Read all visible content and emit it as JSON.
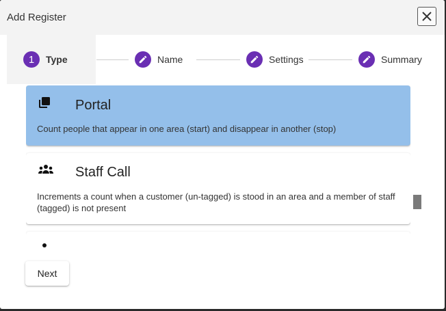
{
  "dialog": {
    "title": "Add Register",
    "close_icon": "close-icon"
  },
  "stepper": {
    "steps": [
      {
        "marker": "1",
        "label": "Type",
        "state": "active"
      },
      {
        "marker": "edit-icon",
        "label": "Name",
        "state": "pending"
      },
      {
        "marker": "edit-icon",
        "label": "Settings",
        "state": "pending"
      },
      {
        "marker": "edit-icon",
        "label": "Summary",
        "state": "pending"
      }
    ],
    "accent_color": "#6a2fb3"
  },
  "register_types": [
    {
      "icon": "copy-stack-icon",
      "title": "Portal",
      "description": "Count people that appear in one area (start) and disappear in another (stop)",
      "selected": true
    },
    {
      "icon": "people-group-icon",
      "title": "Staff Call",
      "description": "Increments a count when a customer (un-tagged) is stood in an area and a member of staff (tagged) is not present",
      "selected": false
    },
    {
      "icon": "person-icon",
      "title": "",
      "description": "",
      "selected": false
    }
  ],
  "colors": {
    "selected_card": "#94bfea",
    "header_bg": "#f3f3f3"
  },
  "actions": {
    "next_label": "Next"
  }
}
